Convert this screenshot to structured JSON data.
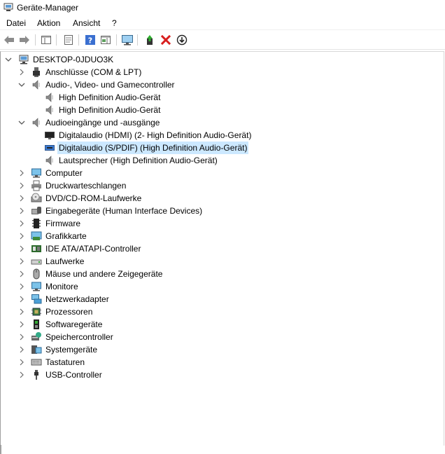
{
  "window": {
    "title": "Geräte-Manager"
  },
  "menu": {
    "items": [
      "Datei",
      "Aktion",
      "Ansicht",
      "?"
    ]
  },
  "toolbar": {
    "buttons": [
      {
        "name": "back",
        "icon": "arrow-left-icon"
      },
      {
        "name": "forward",
        "icon": "arrow-right-icon"
      },
      {
        "name": "show-hide-console-tree",
        "icon": "console-tree-icon"
      },
      {
        "name": "properties",
        "icon": "properties-icon"
      },
      {
        "name": "help",
        "icon": "help-icon"
      },
      {
        "name": "show-action-pane",
        "icon": "action-pane-icon"
      },
      {
        "name": "scan-hardware",
        "icon": "monitor-scan-icon"
      },
      {
        "name": "update-driver",
        "icon": "update-driver-icon"
      },
      {
        "name": "uninstall-device",
        "icon": "red-x-icon"
      },
      {
        "name": "disable-device",
        "icon": "down-arrow-circle-icon"
      }
    ]
  },
  "tree": {
    "root": "DESKTOP-0JDUO3K",
    "rows": [
      {
        "label": "Anschlüsse (COM & LPT)",
        "level": 1,
        "state": "collapsed",
        "icon": "port-icon"
      },
      {
        "label": "Audio-, Video- und Gamecontroller",
        "level": 1,
        "state": "expanded",
        "icon": "speaker-icon"
      },
      {
        "label": "High Definition Audio-Gerät",
        "level": 2,
        "state": "leaf",
        "icon": "speaker-icon"
      },
      {
        "label": "High Definition Audio-Gerät",
        "level": 2,
        "state": "leaf",
        "icon": "speaker-icon"
      },
      {
        "label": "Audioeingänge und -ausgänge",
        "level": 1,
        "state": "expanded",
        "icon": "speaker-icon"
      },
      {
        "label": "Digitalaudio (HDMI) (2- High Definition Audio-Gerät)",
        "level": 2,
        "state": "leaf",
        "icon": "display-audio-icon"
      },
      {
        "label": "Digitalaudio (S/PDIF) (High Definition Audio-Gerät)",
        "level": 2,
        "state": "leaf",
        "icon": "spdif-icon",
        "selected": true
      },
      {
        "label": "Lautsprecher (High Definition Audio-Gerät)",
        "level": 2,
        "state": "leaf",
        "icon": "speaker-icon"
      },
      {
        "label": "Computer",
        "level": 1,
        "state": "collapsed",
        "icon": "computer-icon"
      },
      {
        "label": "Druckwarteschlangen",
        "level": 1,
        "state": "collapsed",
        "icon": "printer-icon"
      },
      {
        "label": "DVD/CD-ROM-Laufwerke",
        "level": 1,
        "state": "collapsed",
        "icon": "dvd-drive-icon"
      },
      {
        "label": "Eingabegeräte (Human Interface Devices)",
        "level": 1,
        "state": "collapsed",
        "icon": "hid-icon"
      },
      {
        "label": "Firmware",
        "level": 1,
        "state": "collapsed",
        "icon": "firmware-icon"
      },
      {
        "label": "Grafikkarte",
        "level": 1,
        "state": "collapsed",
        "icon": "display-adapter-icon"
      },
      {
        "label": "IDE ATA/ATAPI-Controller",
        "level": 1,
        "state": "collapsed",
        "icon": "ide-controller-icon"
      },
      {
        "label": "Laufwerke",
        "level": 1,
        "state": "collapsed",
        "icon": "disk-drive-icon"
      },
      {
        "label": "Mäuse und andere Zeigegeräte",
        "level": 1,
        "state": "collapsed",
        "icon": "mouse-icon"
      },
      {
        "label": "Monitore",
        "level": 1,
        "state": "collapsed",
        "icon": "monitor-icon"
      },
      {
        "label": "Netzwerkadapter",
        "level": 1,
        "state": "collapsed",
        "icon": "network-adapter-icon"
      },
      {
        "label": "Prozessoren",
        "level": 1,
        "state": "collapsed",
        "icon": "processor-icon"
      },
      {
        "label": "Softwaregeräte",
        "level": 1,
        "state": "collapsed",
        "icon": "software-device-icon"
      },
      {
        "label": "Speichercontroller",
        "level": 1,
        "state": "collapsed",
        "icon": "storage-controller-icon"
      },
      {
        "label": "Systemgeräte",
        "level": 1,
        "state": "collapsed",
        "icon": "system-device-icon"
      },
      {
        "label": "Tastaturen",
        "level": 1,
        "state": "collapsed",
        "icon": "keyboard-icon"
      },
      {
        "label": "USB-Controller",
        "level": 1,
        "state": "collapsed",
        "icon": "usb-icon"
      }
    ]
  },
  "colors": {
    "selection": "#cce8ff",
    "accent": "#2d7dd2",
    "danger": "#d81e1e",
    "chevron": "#5a5a5a"
  }
}
